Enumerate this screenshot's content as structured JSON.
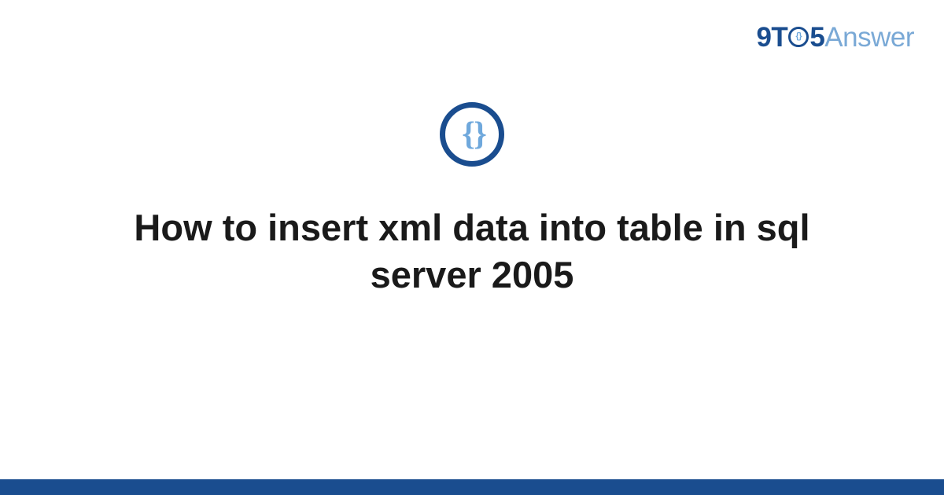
{
  "brand": {
    "part_nine": "9",
    "part_t": "T",
    "part_o_inner": "{}",
    "part_five": "5",
    "part_answer": "Answer"
  },
  "icon": {
    "braces_text": "{ }",
    "name": "code-braces-icon"
  },
  "title": "How to insert xml data into table in sql server 2005",
  "colors": {
    "primary": "#1a4d8f",
    "accent": "#6fa8dc",
    "text": "#1a1a1a"
  }
}
